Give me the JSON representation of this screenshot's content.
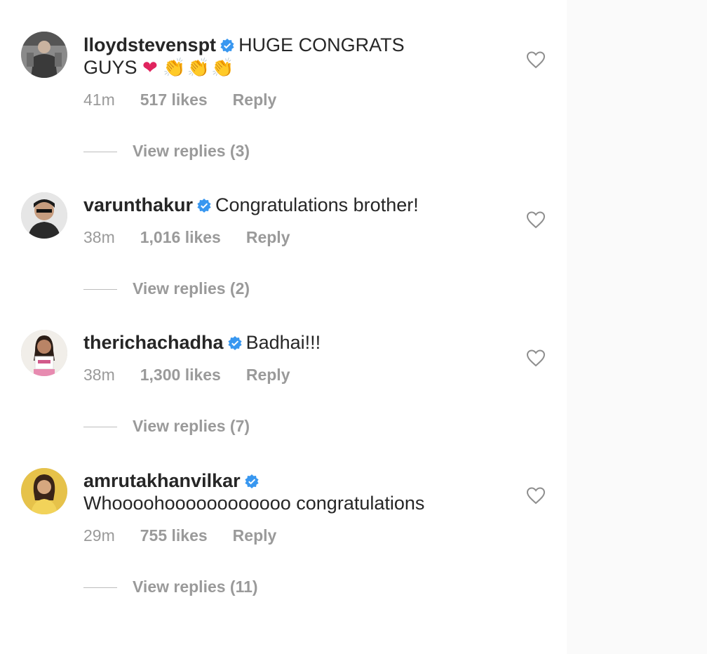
{
  "comments": [
    {
      "username": "lloydstevenspt",
      "verified": true,
      "text_line1": "HUGE CONGRATS",
      "text_line2": "GUYS",
      "heart_emoji": "❤",
      "clap_emoji": "👏👏👏",
      "time": "41m",
      "likes": "517 likes",
      "reply_label": "Reply",
      "view_replies": "View replies (3)",
      "avatar": "avatar-lloydstevenspt"
    },
    {
      "username": "varunthakur",
      "verified": true,
      "text": "Congratulations brother!",
      "time": "38m",
      "likes": "1,016 likes",
      "reply_label": "Reply",
      "view_replies": "View replies (2)",
      "avatar": "avatar-varunthakur"
    },
    {
      "username": "therichachadha",
      "verified": true,
      "text": "Badhai!!!",
      "time": "38m",
      "likes": "1,300 likes",
      "reply_label": "Reply",
      "view_replies": "View replies (7)",
      "avatar": "avatar-therichachadha"
    },
    {
      "username": "amrutakhanvilkar",
      "verified": true,
      "text": "Whoooohoooooooooooo congratulations",
      "time": "29m",
      "likes": "755 likes",
      "reply_label": "Reply",
      "view_replies": "View replies (11)",
      "avatar": "avatar-amrutakhanvilkar"
    }
  ],
  "icons": {
    "like": "heart-outline-icon",
    "verified": "verified-badge-icon"
  },
  "colors": {
    "verified_blue": "#3897f0",
    "muted_text": "#9a9a9a",
    "primary_text": "#262626"
  }
}
